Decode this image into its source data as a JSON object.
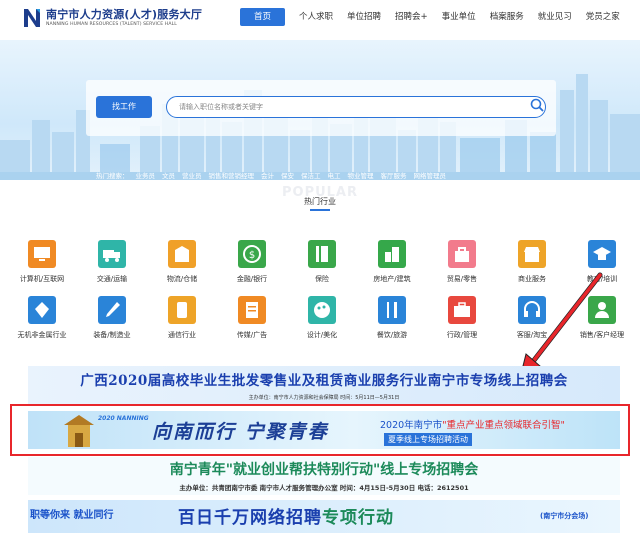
{
  "header": {
    "logo_cn": "南宁市人力资源(人才)服务大厅",
    "logo_en": "NANNING HUMAN RESOURCES (TALENT) SERVICE HALL",
    "nav": [
      "首页",
      "个人求职",
      "单位招聘",
      "招聘会+",
      "事业单位",
      "档案服务",
      "就业见习",
      "党员之家"
    ]
  },
  "search": {
    "button": "找工作",
    "placeholder": "请输入职位名称或者关键字"
  },
  "hot_search": {
    "label": "热门搜索：",
    "terms": [
      "业务员",
      "文员",
      "营业员",
      "销售和营销经理",
      "会计",
      "保安",
      "保洁工",
      "电工",
      "物业管理",
      "客厅服务",
      "网络管理员"
    ]
  },
  "popular": {
    "watermark": "POPULAR",
    "title": "热门行业"
  },
  "industries": [
    {
      "label": "计算机/互联网",
      "icon": "computer-icon",
      "color": "#f08a24"
    },
    {
      "label": "交通/运输",
      "icon": "truck-icon",
      "color": "#2fb5a8"
    },
    {
      "label": "物流/仓储",
      "icon": "box-icon",
      "color": "#f0a028"
    },
    {
      "label": "金融/银行",
      "icon": "coin-icon",
      "color": "#3aa74a"
    },
    {
      "label": "保险",
      "icon": "book-icon",
      "color": "#3aa74a"
    },
    {
      "label": "房地产/建筑",
      "icon": "building-icon",
      "color": "#35a84a"
    },
    {
      "label": "贸易/零售",
      "icon": "bag-icon",
      "color": "#f27b8c"
    },
    {
      "label": "商业服务",
      "icon": "shop-icon",
      "color": "#eea428"
    },
    {
      "label": "教育/培训",
      "icon": "graduation-icon",
      "color": "#2a84d8"
    },
    {
      "label": "无机非金属行业",
      "icon": "mineral-icon",
      "color": "#2a84d8"
    },
    {
      "label": "装备/制造业",
      "icon": "tool-icon",
      "color": "#2a84d8"
    },
    {
      "label": "通信行业",
      "icon": "phone-icon",
      "color": "#eea428"
    },
    {
      "label": "传媒/广告",
      "icon": "document-icon",
      "color": "#f08a24"
    },
    {
      "label": "设计/美化",
      "icon": "palette-icon",
      "color": "#2fb5a8"
    },
    {
      "label": "餐饮/旅游",
      "icon": "utensils-icon",
      "color": "#2a84d8"
    },
    {
      "label": "行政/管理",
      "icon": "briefcase-icon",
      "color": "#e8483e"
    },
    {
      "label": "客服/淘宝",
      "icon": "headset-icon",
      "color": "#2a84d8"
    },
    {
      "label": "销售/客户经理",
      "icon": "person-icon",
      "color": "#3aa74a"
    }
  ],
  "banners": {
    "b1_title": "广西2020届高校毕业生批发零售业及租赁商业服务行业南宁市专场线上招聘会",
    "b1_sub": "主办单位：南宁市人力资源和社会保障局      时间：5月11日—5月31日",
    "b2_logo": "2020 NANNING",
    "b2_calligraphy": "向南而行 宁聚青春",
    "b2_title_a": "2020年南宁市",
    "b2_title_b": "\"重点产业重点领域联合引智\"",
    "b2_sub": "夏季线上专场招聘活动",
    "b3_title": "南宁青年\"就业创业帮扶特别行动\"线上专场招聘会",
    "b3_sub": "主办单位：共青团南宁市委   南宁市人才服务管理办公室   时间：4月15日-5月30日  电话：2612501",
    "b4_left": "职等你来 就业同行",
    "b4_title_a": "百日千万网络招聘",
    "b4_title_b": "专项行动",
    "b4_right": "(南宁市分会场)"
  },
  "colors": {
    "accent": "#2a73d9",
    "highlight_frame": "#e8262b"
  }
}
